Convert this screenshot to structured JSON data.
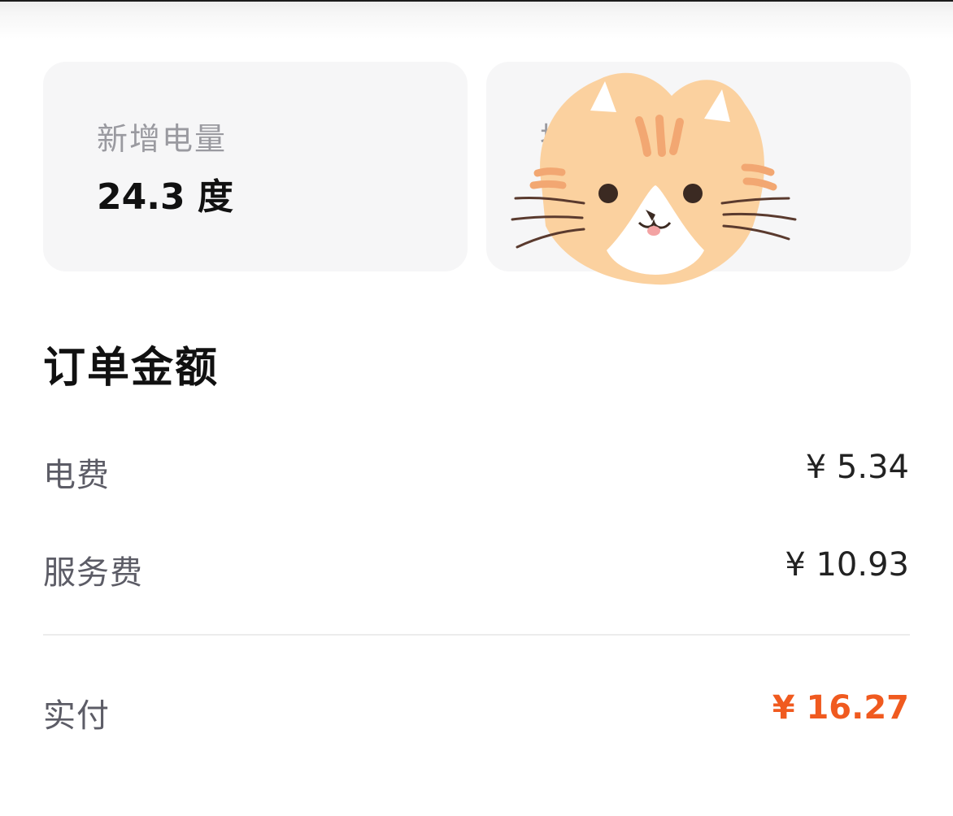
{
  "stats": {
    "added_energy": {
      "label": "新增电量",
      "value": "24.3 度"
    },
    "swap": {
      "label": "换"
    }
  },
  "order": {
    "title": "订单金额",
    "rows": [
      {
        "label": "电费",
        "amount": "¥ 5.34"
      },
      {
        "label": "服务费",
        "amount": "¥ 10.93"
      }
    ],
    "total": {
      "label": "实付",
      "amount": "¥ 16.27"
    }
  },
  "colors": {
    "accent_total": "#f05a1f",
    "card_bg": "#f6f6f7",
    "cat_fur": "#fbd19f",
    "cat_stripe": "#f2a772"
  },
  "icons": {
    "sticker": "cat-face-sticker"
  }
}
